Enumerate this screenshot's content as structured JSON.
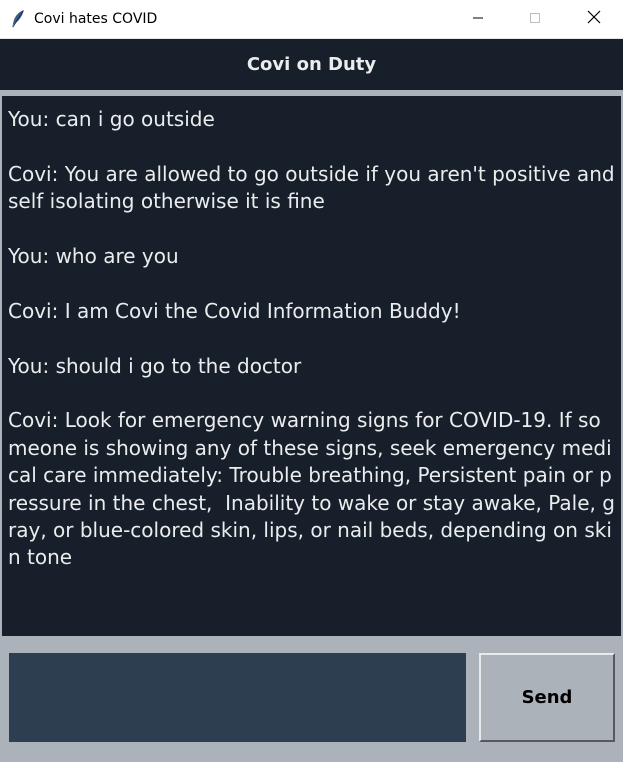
{
  "window": {
    "title": "Covi hates COVID"
  },
  "header": {
    "title": "Covi on Duty"
  },
  "chat": {
    "messages": [
      "You: can i go outside",
      "Covi: You are allowed to go outside if you aren't positive and self isolating otherwise it is fine",
      "You: who are you",
      "Covi: I am Covi the Covid Information Buddy!",
      "You: should i go to the doctor",
      "Covi: Look for emergency warning signs for COVID-19. If someone is showing any of these signs, seek emergency medical care immediately: Trouble breathing, Persistent pain or pressure in the chest,  Inability to wake or stay awake, Pale, gray, or blue-colored skin, lips, or nail beds, depending on skin tone"
    ]
  },
  "input": {
    "value": ""
  },
  "send_button": {
    "label": "Send"
  },
  "colors": {
    "background": "#ABB2B9",
    "chat_background": "#17202A",
    "text": "#EAECEE",
    "entry_background": "#2C3E50"
  },
  "icons": {
    "app": "feather-icon",
    "minimize": "minimize-icon",
    "maximize": "maximize-icon",
    "close": "close-icon"
  }
}
